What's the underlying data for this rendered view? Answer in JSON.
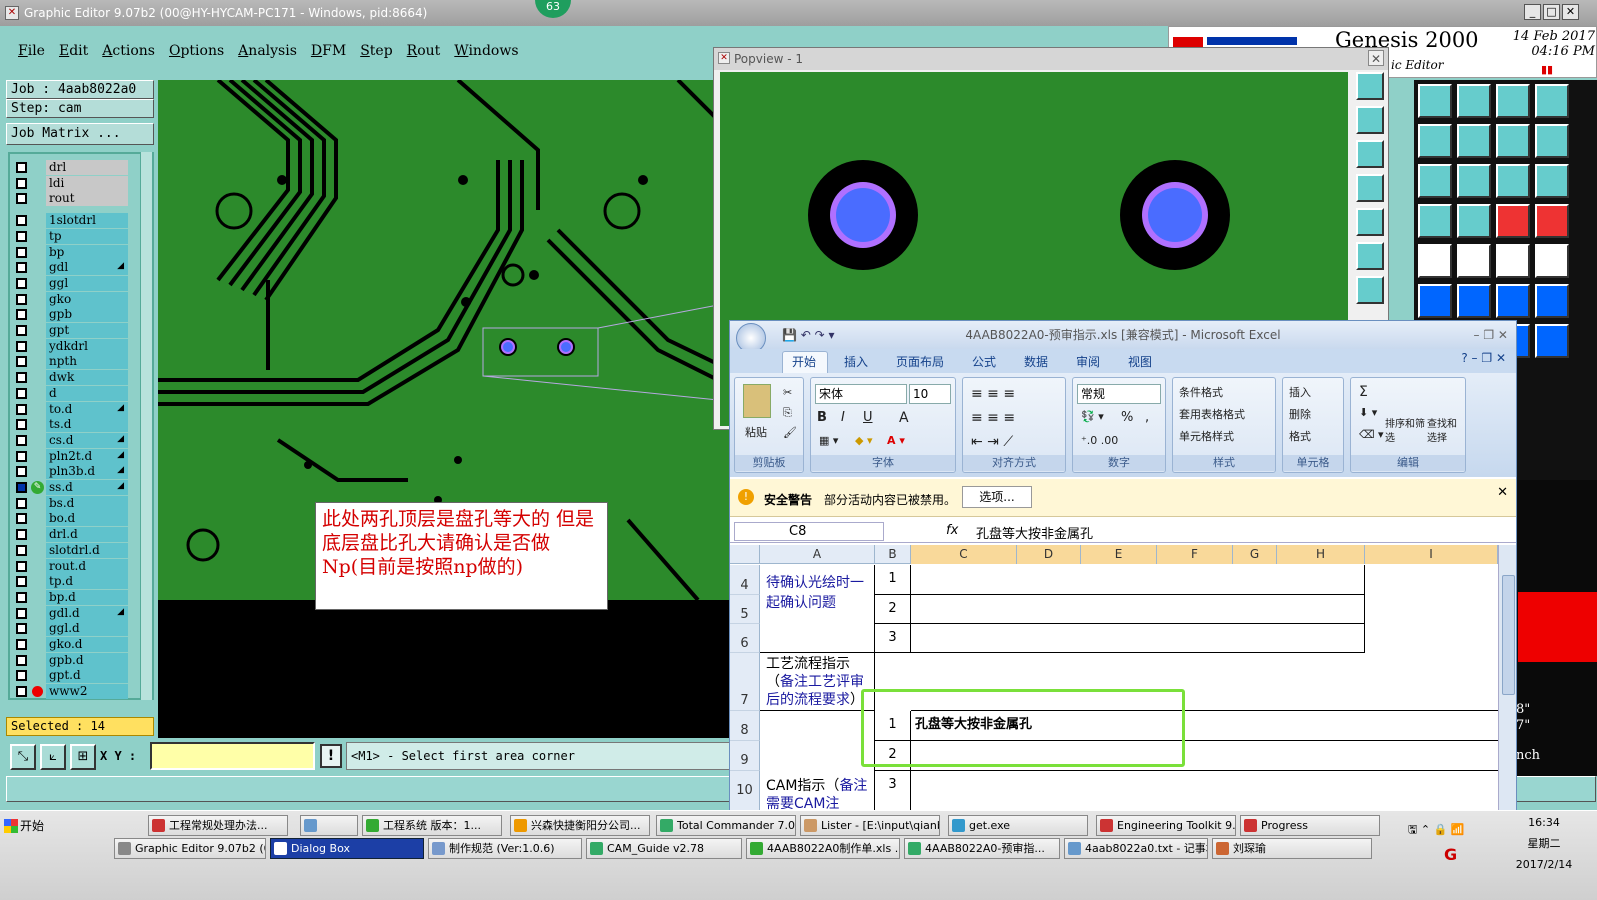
{
  "ge": {
    "title": "Graphic Editor 9.07b2 (00@HY-HYCAM-PC171 - Windows, pid:8664)",
    "badge": "63",
    "menu": [
      "File",
      "Edit",
      "Actions",
      "Options",
      "Analysis",
      "DFM",
      "Step",
      "Rout",
      "Windows"
    ],
    "job_line": "Job : 4aab8022a0",
    "step_line": "Step: cam",
    "job_matrix": "Job Matrix ...",
    "layers": [
      "drl",
      "ldi",
      "rout",
      "1slotdrl",
      "tp",
      "bp",
      "gdl",
      "ggl",
      "gko",
      "gpb",
      "gpt",
      "ydkdrl",
      "npth",
      "dwk",
      "d",
      "to.d",
      "ts.d",
      "cs.d",
      "pln2t.d",
      "pln3b.d",
      "ss.d",
      "bs.d",
      "bo.d",
      "drl.d",
      "slotdrl.d",
      "rout.d",
      "tp.d",
      "bp.d",
      "gdl.d",
      "ggl.d",
      "gko.d",
      "gpb.d",
      "gpt.d",
      "www2"
    ],
    "selected": "Selected : 14",
    "xy_label": "X Y :",
    "warn": "!",
    "prompt": "<M1> - Select first area corner"
  },
  "annotation": "此处两孔顶层是盘孔等大的 但是底层盘比孔大请确认是否做Np(目前是按照np做的)",
  "popview": {
    "title": "Popview - 1",
    "close": "✕"
  },
  "genesis": {
    "brand": "Genesis 2000",
    "date": "14 Feb 2017",
    "time": "04:16 PM",
    "subtitle": "ic Editor",
    "right_texts": [
      "8\"",
      "7\"",
      "nch"
    ]
  },
  "excel": {
    "title": "4AAB8022A0-预审指示.xls [兼容模式] - Microsoft Excel",
    "tabs": [
      "开始",
      "插入",
      "页面布局",
      "公式",
      "数据",
      "审阅",
      "视图"
    ],
    "clipboard": {
      "paste": "粘贴",
      "label": "剪贴板"
    },
    "font": {
      "name": "宋体",
      "size": "10",
      "bold": "B",
      "italic": "I",
      "underline": "U",
      "grow": "A",
      "label": "字体"
    },
    "align_label": "对齐方式",
    "number": {
      "format": "常规",
      "percent": "%",
      "comma": ",",
      "label": "数字"
    },
    "styles": {
      "cond": "条件格式",
      "table": "套用表格格式",
      "cell": "单元格样式",
      "label": "样式"
    },
    "cells": {
      "insert": "插入",
      "delete": "删除",
      "format": "格式",
      "label": "单元格"
    },
    "editing": {
      "sigma": "Σ",
      "sort": "排序和筛选",
      "find": "查找和选择",
      "label": "编辑"
    },
    "security": {
      "title": "安全警告",
      "text": "部分活动内容已被禁用。",
      "options": "选项..."
    },
    "namebox": "C8",
    "fx": "fx",
    "formula": "孔盘等大按非金属孔",
    "columns": [
      "A",
      "B",
      "C",
      "D",
      "E",
      "F",
      "G",
      "H",
      "I"
    ],
    "rows": [
      {
        "num": "4",
        "b": "1",
        "c": ""
      },
      {
        "num": "5",
        "b": "2",
        "c": ""
      },
      {
        "num": "6",
        "b": "3",
        "c": ""
      },
      {
        "num": "7",
        "b": "",
        "c": ""
      },
      {
        "num": "8",
        "b": "1",
        "c": "孔盘等大按非金属孔"
      },
      {
        "num": "9",
        "b": "2",
        "c": ""
      },
      {
        "num": "10",
        "b": "3",
        "c": ""
      }
    ],
    "a_group1": "待确认光绘时一起确认问题",
    "a_group2_black": "工艺流程指示（",
    "a_group2_blue": "备注工艺评审后的流程要求",
    "a_group2_end": "）",
    "a_group3_black": "CAM指示（",
    "a_group3_blue": "备注需要CAM注"
  },
  "taskbar": {
    "start": "开始",
    "row1": [
      "工程常规处理办法...",
      "",
      "工程系统 版本：1...",
      "兴森快捷衡阳分公司...",
      "Total Commander 7.0 ...",
      "Lister - [E:\\input\\qianb...",
      "get.exe",
      "Engineering Toolkit 9....",
      "Progress"
    ],
    "row2": [
      "Graphic Editor 9.07b2 (0...",
      "Dialog Box",
      "制作规范 (Ver:1.0.6)",
      "CAM_Guide v2.78",
      "4AAB8022A0制作单.xls ...",
      "4AAB8022A0-预审指...",
      "4aab8022a0.txt - 记事本",
      "刘琛瑜"
    ],
    "time": "16:34",
    "weekday": "星期二",
    "date": "2017/2/14"
  },
  "colors": {
    "pcb_green": "#2c8a2b",
    "layer_cyan": "#5fc2cc",
    "annot_red": "#d40000",
    "highlight": "#7ae03a",
    "pad_blue": "#4a6cff",
    "pad_ring": "#b070ff"
  }
}
